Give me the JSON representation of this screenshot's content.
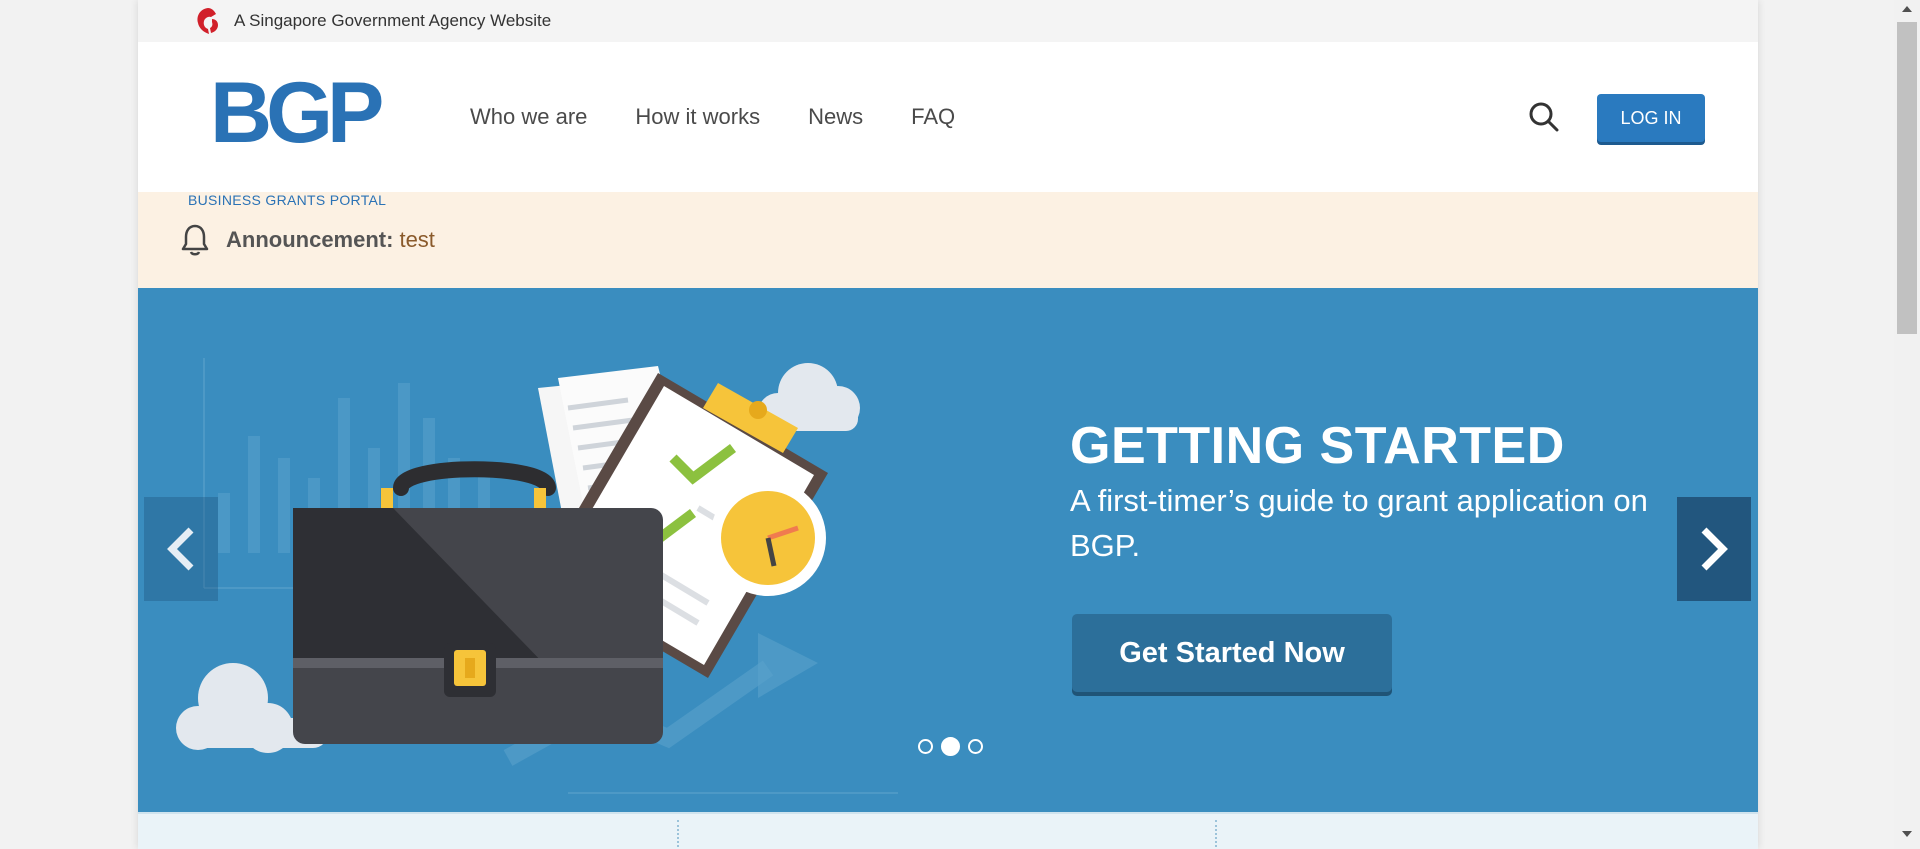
{
  "masthead": {
    "text": "A Singapore Government Agency Website",
    "icon": "lion-head-icon"
  },
  "logo": {
    "letters": "BGP",
    "subtitle": "BUSINESS GRANTS PORTAL"
  },
  "nav": {
    "items": [
      {
        "label": "Who we are"
      },
      {
        "label": "How it works"
      },
      {
        "label": "News"
      },
      {
        "label": "FAQ"
      }
    ]
  },
  "header": {
    "login_label": "LOG IN"
  },
  "announcement": {
    "label": "Announcement:",
    "text": "test"
  },
  "hero": {
    "title": "GETTING STARTED",
    "subtitle": "A first-timer’s guide to grant application on BGP.",
    "cta_label": "Get Started Now",
    "active_slide": 2,
    "slide_count": 3
  },
  "colors": {
    "brand_blue": "#2a72b5",
    "hero_bg": "#3a8dbf",
    "cta": "#2c6f9a",
    "announcement_bg": "#fcf1e3"
  }
}
